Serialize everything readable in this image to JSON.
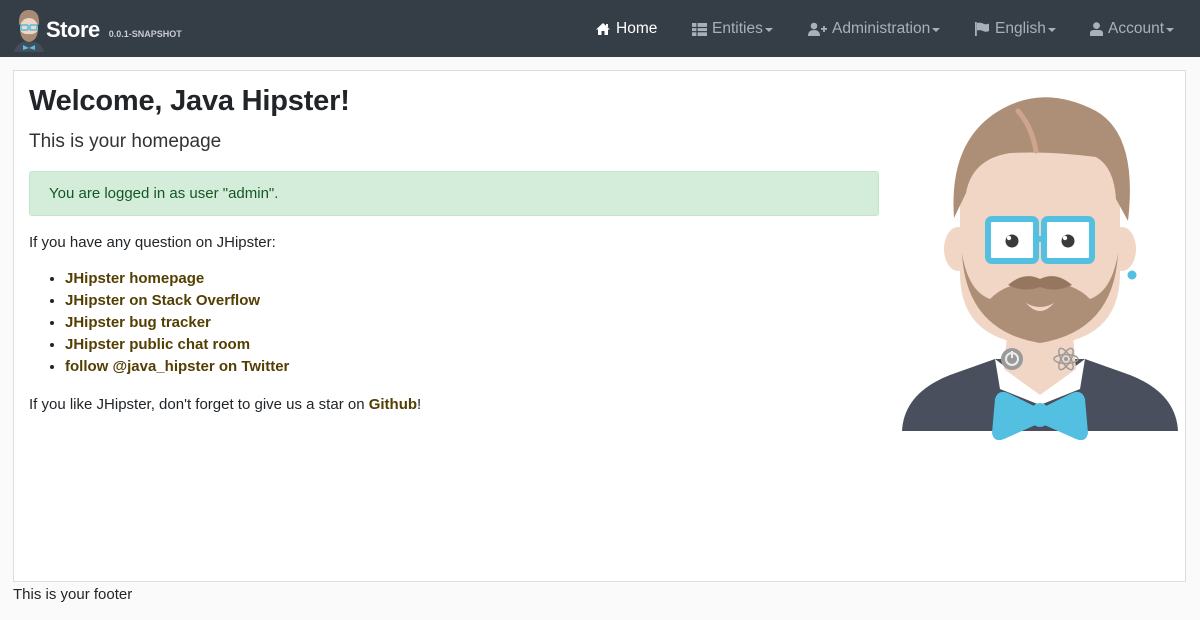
{
  "brand": {
    "title": "Store",
    "version": "0.0.1-SNAPSHOT"
  },
  "nav": {
    "home": "Home",
    "entities": "Entities",
    "administration": "Administration",
    "language": "English",
    "account": "Account"
  },
  "main": {
    "welcome": "Welcome, Java Hipster!",
    "lead": "This is your homepage",
    "alert": "You are logged in as user \"admin\".",
    "question": "If you have any question on JHipster:",
    "links": [
      "JHipster homepage",
      "JHipster on Stack Overflow",
      "JHipster bug tracker",
      "JHipster public chat room",
      "follow @java_hipster on Twitter"
    ],
    "star_prefix": "If you like JHipster, don't forget to give us a star on ",
    "star_link": "Github",
    "star_suffix": "!"
  },
  "footer": {
    "text": "This is your footer"
  },
  "colors": {
    "navbar": "#353d47",
    "link": "#533f03",
    "alert_bg": "#d4edda",
    "alert_text": "#155724"
  },
  "icons": [
    "hipster-logo-icon",
    "home-icon",
    "table-icon",
    "user-plus-icon",
    "flag-icon",
    "user-icon",
    "caret-down-icon",
    "hipster-illustration"
  ]
}
